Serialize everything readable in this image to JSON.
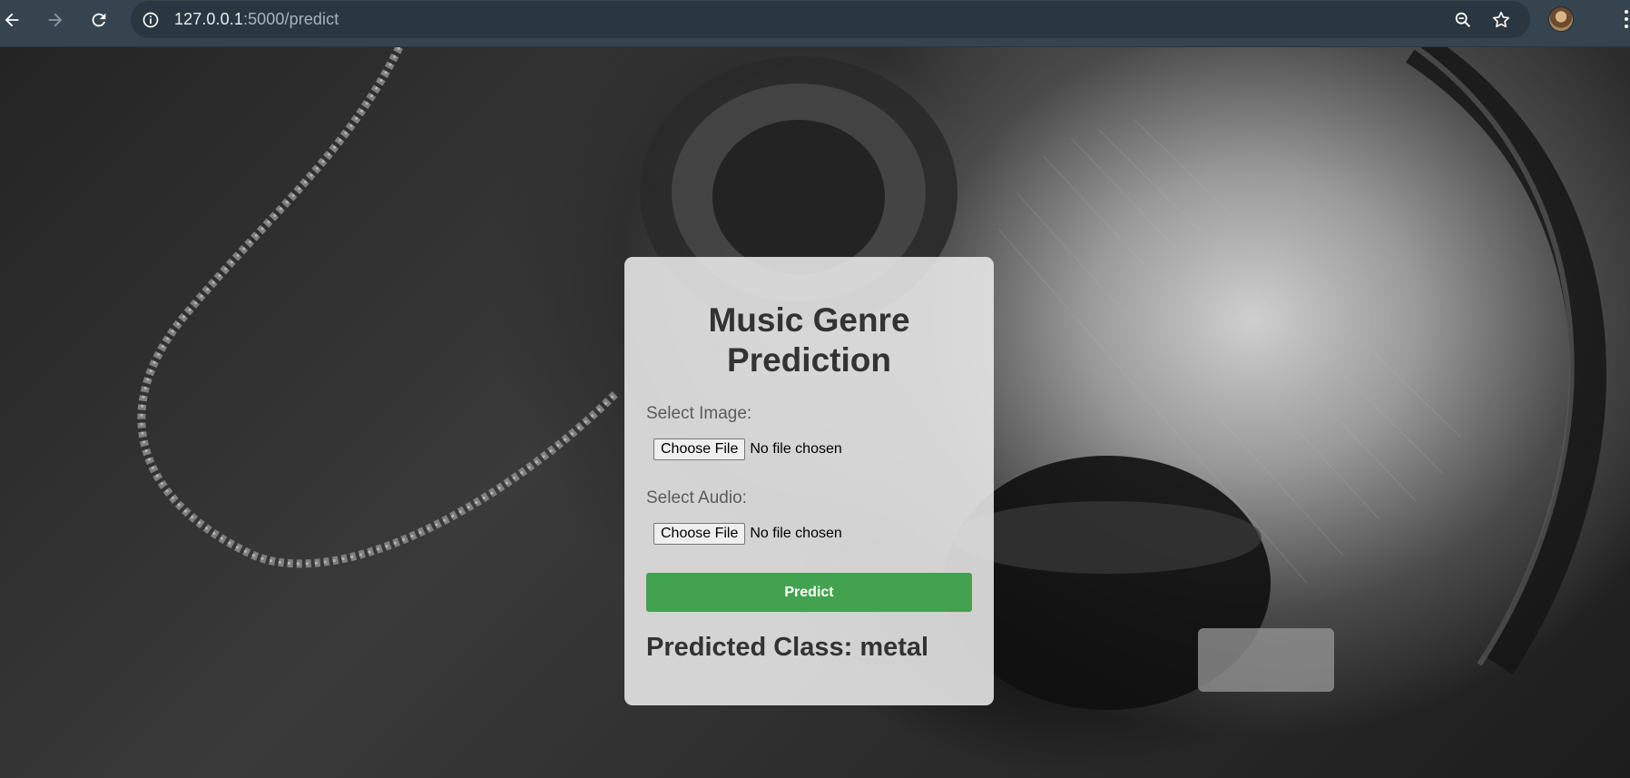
{
  "browser": {
    "url_host": "127.0.0.1",
    "url_path": ":5000/predict",
    "icons": {
      "back": "arrow-left-icon",
      "forward": "arrow-right-icon",
      "reload": "reload-icon",
      "site_info": "info-icon",
      "zoom": "zoom-icon",
      "bookmark": "star-icon",
      "profile": "avatar",
      "menu": "kebab-menu-icon"
    }
  },
  "page": {
    "title": "Music Genre Prediction",
    "image_field": {
      "label": "Select Image:",
      "button": "Choose File",
      "status": "No file chosen"
    },
    "audio_field": {
      "label": "Select Audio:",
      "button": "Choose File",
      "status": "No file chosen"
    },
    "predict_button": "Predict",
    "result_text": "Predicted Class: metal"
  },
  "colors": {
    "accent_button": "#43a24f",
    "chrome_bg": "#35444f"
  }
}
